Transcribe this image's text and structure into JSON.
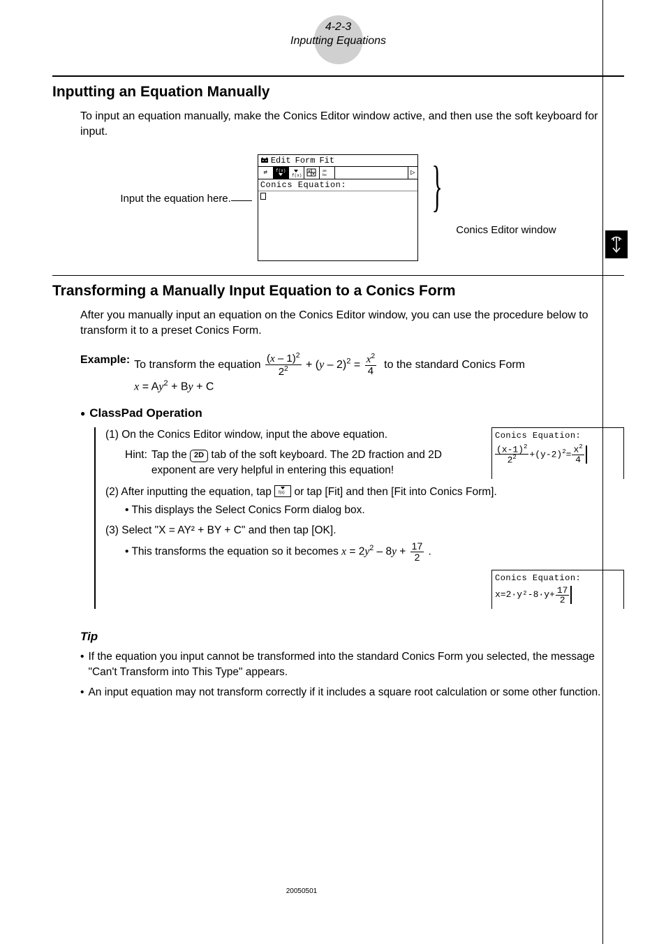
{
  "header": {
    "section_number": "4-2-3",
    "section_title": "Inputting Equations"
  },
  "section1": {
    "heading": "Inputting an Equation Manually",
    "intro": "To input an equation manually, make the Conics Editor window active, and then use the soft keyboard for input.",
    "caption_left": "Input the equation here.",
    "caption_right": "Conics Editor window",
    "editor": {
      "menu_items": [
        "Edit",
        "Form",
        "Fit"
      ],
      "panel_label": "Conics Equation:"
    }
  },
  "section2": {
    "heading": "Transforming a Manually Input Equation to a Conics Form",
    "intro": "After you manually input an equation on the Conics Editor window, you can use the procedure below to transform it to a preset Conics Form.",
    "example_label": "Example:",
    "example_pre": "To transform the equation",
    "example_post": "to the standard Conics Form",
    "example_form": "x = Ay² + By + C",
    "classpad_heading": "ClassPad Operation",
    "step1_a": "(1) On the Conics Editor window, input the above equation.",
    "hint_label": "Hint:",
    "hint_pre": "Tap the",
    "key_2d": "2D",
    "hint_post": "tab of the soft keyboard. The 2D fraction and 2D exponent are very helpful in entering this equation!",
    "snippet1_title": "Conics Equation:",
    "step2_a": "(2) After inputting the equation, tap",
    "step2_b": "or tap [Fit] and then [Fit into Conics Form].",
    "step2_bullet": "This displays the Select Conics Form dialog box.",
    "step3_a": "(3) Select \"X = AY² + BY + C\" and then tap [OK].",
    "step3_bullet_pre": "This transforms the equation so it becomes",
    "snippet2_title": "Conics Equation:",
    "snippet2_eq": "x=2·y²-8·y+",
    "snippet2_frac_n": "17",
    "snippet2_frac_d": "2"
  },
  "tip": {
    "heading": "Tip",
    "item1": "If the equation you input cannot be transformed into the standard Conics Form you selected, the message \"Can't Transform into This Type\" appears.",
    "item2": "An input equation may not transform correctly if it includes a square root calculation or some other function."
  },
  "footer": "20050501"
}
